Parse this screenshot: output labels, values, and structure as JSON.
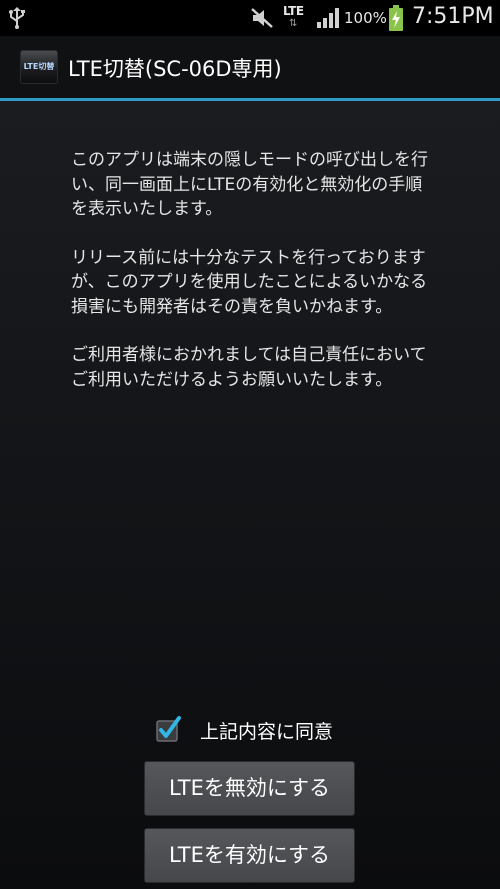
{
  "status_bar": {
    "usb_icon": "usb-icon",
    "mute_icon": "mute-icon",
    "network_label": "LTE",
    "signal_icon": "signal-icon",
    "battery_percent": "100%",
    "battery_icon": "battery-charging-icon",
    "time": "7:51PM"
  },
  "title_bar": {
    "icon_label": "LTE切替",
    "title": "LTE切替(SC-06D専用)",
    "accent_color": "#2f9cc8"
  },
  "description": {
    "paragraphs": [
      "このアプリは端末の隠しモードの呼び出しを行い、同一画面上にLTEの有効化と無効化の手順を表示いたします。",
      "リリース前には十分なテストを行っておりますが、このアプリを使用したことによるいかなる損害にも開発者はその責を負いかねます。",
      "ご利用者様におかれましては自己責任においてご利用いただけるようお願いいたします。"
    ]
  },
  "agree": {
    "label": "上記内容に同意",
    "checked": true
  },
  "buttons": {
    "disable_label": "LTEを無効にする",
    "enable_label": "LTEを有効にする"
  }
}
